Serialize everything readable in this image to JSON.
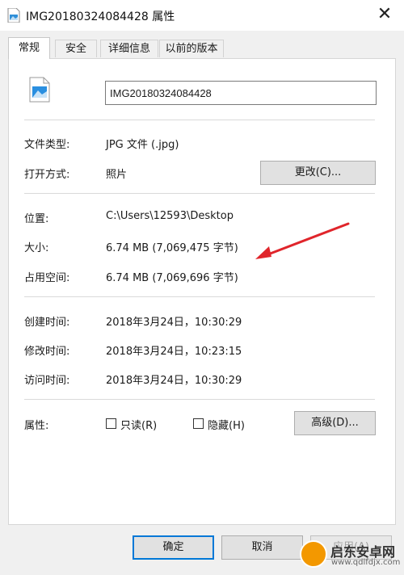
{
  "window": {
    "title": "IMG20180324084428 属性",
    "close_glyph": "✕"
  },
  "tabs": [
    {
      "label": "常规",
      "active": true
    },
    {
      "label": "安全",
      "active": false
    },
    {
      "label": "详细信息",
      "active": false
    },
    {
      "label": "以前的版本",
      "active": false
    }
  ],
  "file": {
    "name": "IMG20180324084428",
    "icon": "image-file-icon"
  },
  "type_section": {
    "type_label": "文件类型:",
    "type_value": "JPG 文件 (.jpg)",
    "open_label": "打开方式:",
    "open_value": "照片",
    "change_button": "更改(C)..."
  },
  "location_section": {
    "location_label": "位置:",
    "location_value": "C:\\Users\\12593\\Desktop",
    "size_label": "大小:",
    "size_value": "6.74 MB (7,069,475 字节)",
    "disk_label": "占用空间:",
    "disk_value": "6.74 MB (7,069,696 字节)"
  },
  "time_section": {
    "created_label": "创建时间:",
    "created_value": "2018年3月24日，10:30:29",
    "modified_label": "修改时间:",
    "modified_value": "2018年3月24日，10:23:15",
    "accessed_label": "访问时间:",
    "accessed_value": "2018年3月24日，10:30:29"
  },
  "attributes": {
    "label": "属性:",
    "readonly": {
      "label": "只读(R)",
      "checked": false
    },
    "hidden": {
      "label": "隐藏(H)",
      "checked": false
    },
    "advanced_button": "高级(D)..."
  },
  "footer": {
    "ok": "确定",
    "cancel": "取消",
    "apply": "应用(A)"
  },
  "watermark": {
    "title": "启东安卓网",
    "url": "www.qdlfdjx.com"
  },
  "colors": {
    "annotation_arrow": "#e0252b",
    "focus_border": "#0078d7"
  }
}
